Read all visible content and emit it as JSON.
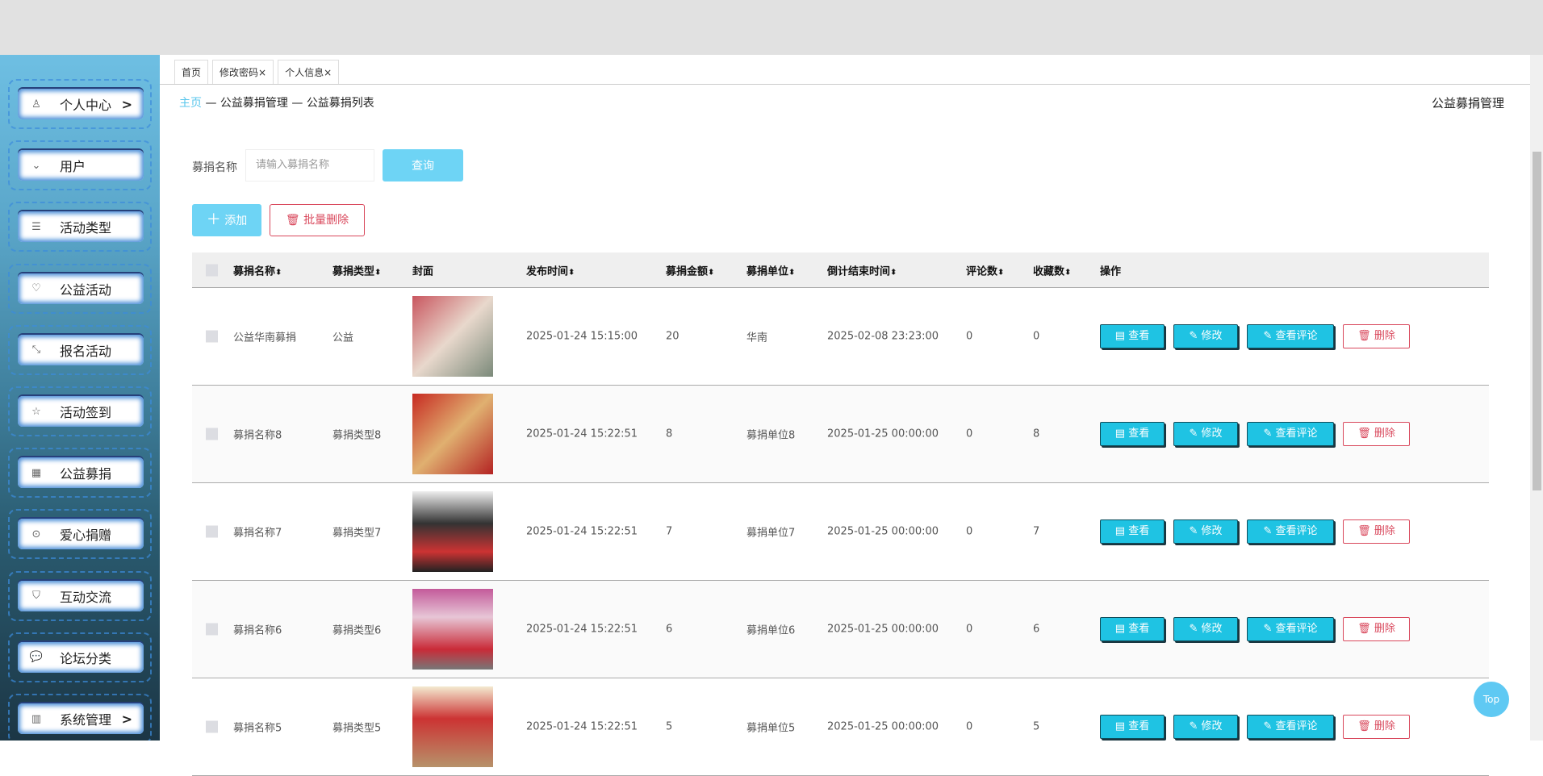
{
  "sidebar": {
    "items": [
      {
        "label": "个人中心",
        "icon": "user-icon",
        "arrow": true
      },
      {
        "label": "用户",
        "icon": "circle-chevron-icon"
      },
      {
        "label": "活动类型",
        "icon": "list-icon"
      },
      {
        "label": "公益活动",
        "icon": "heart-icon"
      },
      {
        "label": "报名活动",
        "icon": "shrink-icon"
      },
      {
        "label": "活动签到",
        "icon": "star-icon"
      },
      {
        "label": "公益募捐",
        "icon": "chart-icon"
      },
      {
        "label": "爱心捐赠",
        "icon": "target-icon"
      },
      {
        "label": "互动交流",
        "icon": "shield-icon"
      },
      {
        "label": "论坛分类",
        "icon": "chat-icon"
      },
      {
        "label": "系统管理",
        "icon": "bar-chart-icon",
        "arrow": true
      }
    ]
  },
  "tabs": [
    {
      "label": "首页"
    },
    {
      "label": "修改密码",
      "close": "×"
    },
    {
      "label": "个人信息",
      "close": "×"
    }
  ],
  "breadcrumb": {
    "home": "主页",
    "sep": " — ",
    "l2": "公益募捐管理",
    "l3": "公益募捐列表"
  },
  "page_title": "公益募捐管理",
  "search": {
    "label": "募捐名称",
    "placeholder": "请输入募捐名称",
    "button": "查询"
  },
  "actions": {
    "add": "添加",
    "batch_delete": "批量删除"
  },
  "table": {
    "headers": [
      "募捐名称",
      "募捐类型",
      "封面",
      "发布时间",
      "募捐金额",
      "募捐单位",
      "倒计结束时间",
      "评论数",
      "收藏数",
      "操作"
    ],
    "sort_glyph": "⬍",
    "rows": [
      {
        "name": "公益华南募捐",
        "type": "公益",
        "time": "2025-01-24 15:15:00",
        "amount": "20",
        "unit": "华南",
        "end": "2025-02-08 23:23:00",
        "comments": "0",
        "favorites": "0"
      },
      {
        "name": "募捐名称8",
        "type": "募捐类型8",
        "time": "2025-01-24 15:22:51",
        "amount": "8",
        "unit": "募捐单位8",
        "end": "2025-01-25 00:00:00",
        "comments": "0",
        "favorites": "8"
      },
      {
        "name": "募捐名称7",
        "type": "募捐类型7",
        "time": "2025-01-24 15:22:51",
        "amount": "7",
        "unit": "募捐单位7",
        "end": "2025-01-25 00:00:00",
        "comments": "0",
        "favorites": "7"
      },
      {
        "name": "募捐名称6",
        "type": "募捐类型6",
        "time": "2025-01-24 15:22:51",
        "amount": "6",
        "unit": "募捐单位6",
        "end": "2025-01-25 00:00:00",
        "comments": "0",
        "favorites": "6"
      },
      {
        "name": "募捐名称5",
        "type": "募捐类型5",
        "time": "2025-01-24 15:22:51",
        "amount": "5",
        "unit": "募捐单位5",
        "end": "2025-01-25 00:00:00",
        "comments": "0",
        "favorites": "5"
      }
    ],
    "ops": {
      "view": "查看",
      "edit": "修改",
      "comments": "查看评论",
      "delete": "删除"
    }
  },
  "top_button": "Top"
}
